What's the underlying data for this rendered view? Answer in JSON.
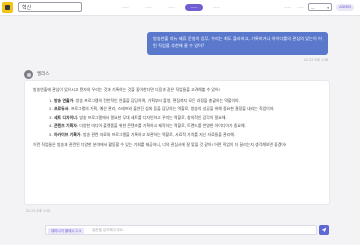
{
  "topbar": {
    "search_value": "혁신",
    "nav": [
      "——",
      "——",
      "——",
      "——",
      "——"
    ],
    "active_nav_index": 3,
    "right_tabs": [
      "——",
      "——"
    ],
    "select_value": "—",
    "admin_label": "ADMIN"
  },
  "user_message": {
    "text": "방송연출 의뉴 제휴 운영의 업무, 우리는 최도 플라하고, 기록하거나 아이디를의 관심의 있는이 어떤 직업을 추천해 줄 수 있어?",
    "time": "02.23 오후 1:58"
  },
  "bot": {
    "name": "엘리스",
    "intro": "방송연출에 관심이 있으시고 텐자의 우리는 것과 기록하는 것을 좋아한다면 다음과 같은 직업들을 고려해볼 수 있어!",
    "items": [
      {
        "num": "1.",
        "title": "방송 연출가",
        "desc": ": 방송 프로그램의 전반적인 연출을 담당하며, 기획부터 촬영, 편집까지 모든 과정을 총괄하는 역할이야."
      },
      {
        "num": "2.",
        "title": "프로듀서",
        "desc": ": 프로그램의 기획, 예산 관리, 스태프와 출연진 섭외 등을 담당하는 역할로, 방송의 성공을 위해 중요한 결정을 내리는 직업이야."
      },
      {
        "num": "3.",
        "title": "세트 디자이너",
        "desc": ": 방송 프로그램에서 필요한 무대 세트를 디자인하고 꾸미는 역할로, 창의적인 감각이 필요해."
      },
      {
        "num": "4.",
        "title": "콘텐츠 기획자",
        "desc": ": 다양한 미디어 플랫폼을 위한 콘텐츠를 기획하고 제작하는 역할로, 트렌드를 반영한 아이디어가 중요해."
      },
      {
        "num": "5.",
        "title": "아카이브 기록가",
        "desc": ": 방송 관련 자료와 프로그램을 기록하고 보관하는 역할로, 사료적 가치를 지닌 자료들을 관리해."
      }
    ],
    "outro": "이런 직업들은 방송과 관련된 다양한 분야에서 활동할 수 있는 기회를 제공하니, 너의 관심사에 잘 맞을 것 같아! 어떤 직업이 더 끌리는지 생각해보면 좋겠어!",
    "time": "02.23 오후 1:58"
  },
  "input": {
    "tag": "제미나이 플래시 2.5",
    "placeholder": "질문을 입력해주세요."
  },
  "colors": {
    "accent": "#6f5fd3",
    "user_bubble": "#5a78cc",
    "logo": "#f2c417"
  }
}
